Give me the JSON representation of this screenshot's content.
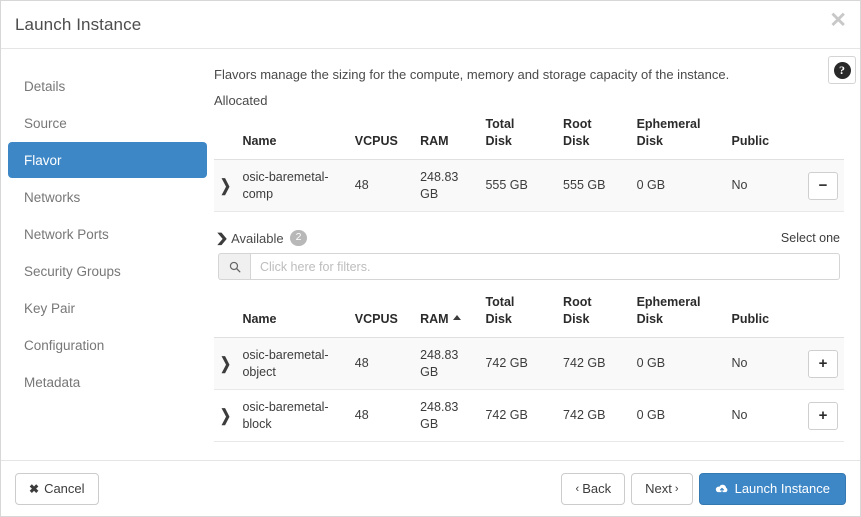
{
  "header": {
    "title": "Launch Instance",
    "close_label": "✕"
  },
  "sidebar": {
    "items": [
      {
        "label": "Details",
        "active": false
      },
      {
        "label": "Source",
        "active": false
      },
      {
        "label": "Flavor",
        "active": true
      },
      {
        "label": "Networks",
        "active": false
      },
      {
        "label": "Network Ports",
        "active": false
      },
      {
        "label": "Security Groups",
        "active": false
      },
      {
        "label": "Key Pair",
        "active": false
      },
      {
        "label": "Configuration",
        "active": false
      },
      {
        "label": "Metadata",
        "active": false
      }
    ]
  },
  "content": {
    "description": "Flavors manage the sizing for the compute, memory and storage capacity of the instance.",
    "allocated_label": "Allocated",
    "help_icon_label": "?",
    "available": {
      "label": "Available",
      "count": "2",
      "select_hint": "Select one",
      "caret": "⌄"
    },
    "filter": {
      "placeholder": "Click here for filters.",
      "value": "",
      "icon": "search-icon"
    },
    "columns": [
      "Name",
      "VCPUS",
      "RAM",
      "Total Disk",
      "Root Disk",
      "Ephemeral Disk",
      "Public"
    ],
    "columns_split": [
      {
        "line1": "Name",
        "line2": ""
      },
      {
        "line1": "VCPUS",
        "line2": ""
      },
      {
        "line1": "RAM",
        "line2": ""
      },
      {
        "line1": "Total",
        "line2": "Disk"
      },
      {
        "line1": "Root",
        "line2": "Disk"
      },
      {
        "line1": "Ephemeral",
        "line2": "Disk"
      },
      {
        "line1": "Public",
        "line2": ""
      }
    ],
    "sorted_column": "RAM",
    "sort_direction": "asc",
    "allocated_rows": [
      {
        "name": "osic-baremetal-comp",
        "vcpus": "48",
        "ram": "248.83 GB",
        "total_disk": "555 GB",
        "root_disk": "555 GB",
        "ephemeral_disk": "0 GB",
        "public": "No",
        "action": "−"
      }
    ],
    "available_rows": [
      {
        "name": "osic-baremetal-object",
        "vcpus": "48",
        "ram": "248.83 GB",
        "total_disk": "742 GB",
        "root_disk": "742 GB",
        "ephemeral_disk": "0 GB",
        "public": "No",
        "action": "+"
      },
      {
        "name": "osic-baremetal-block",
        "vcpus": "48",
        "ram": "248.83 GB",
        "total_disk": "742 GB",
        "root_disk": "742 GB",
        "ephemeral_disk": "0 GB",
        "public": "No",
        "action": "+"
      }
    ]
  },
  "footer": {
    "cancel_label": "Cancel",
    "back_label": "Back",
    "next_label": "Next",
    "launch_label": "Launch Instance"
  },
  "colors": {
    "accent": "#3d87c7",
    "row_bg": "#f9f9f9",
    "badge": "#b8b8b8"
  }
}
